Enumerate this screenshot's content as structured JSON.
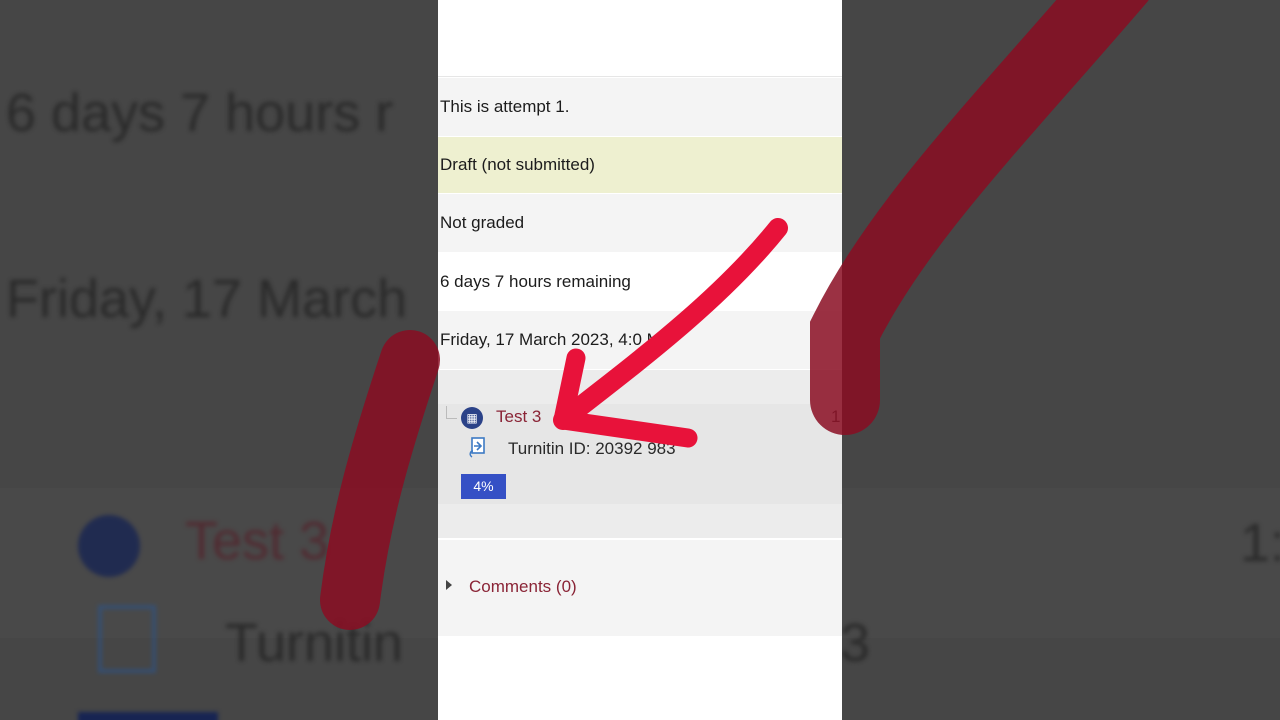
{
  "background": {
    "line1": "6 days 7 hours r",
    "line2": "Friday, 17 March",
    "file_name_partial": "Test 3",
    "turnitin_partial": "Turnitin",
    "right_fragment": "1:",
    "right_fragment_2": "3"
  },
  "submission": {
    "attempt": "This is attempt 1.",
    "status": "Draft (not submitted)",
    "grading": "Not graded",
    "time_remaining": "6 days 7 hours remaining",
    "last_modified": "Friday, 17 March 2023, 4:0  M",
    "file": {
      "name": "Test 3",
      "date_fragment": "1",
      "turnitin_id": "Turnitin ID: 20392  983",
      "similarity": "4%"
    },
    "comments_label": "Comments (0)"
  },
  "colors": {
    "annotation_arrow": "#e8123a",
    "status_highlight": "#eef0d0",
    "link": "#8a2436",
    "similarity_badge": "#3550c5"
  },
  "icons": [
    "file-icon",
    "turnitin-icon",
    "caret-right-icon",
    "arrow-annotation"
  ]
}
